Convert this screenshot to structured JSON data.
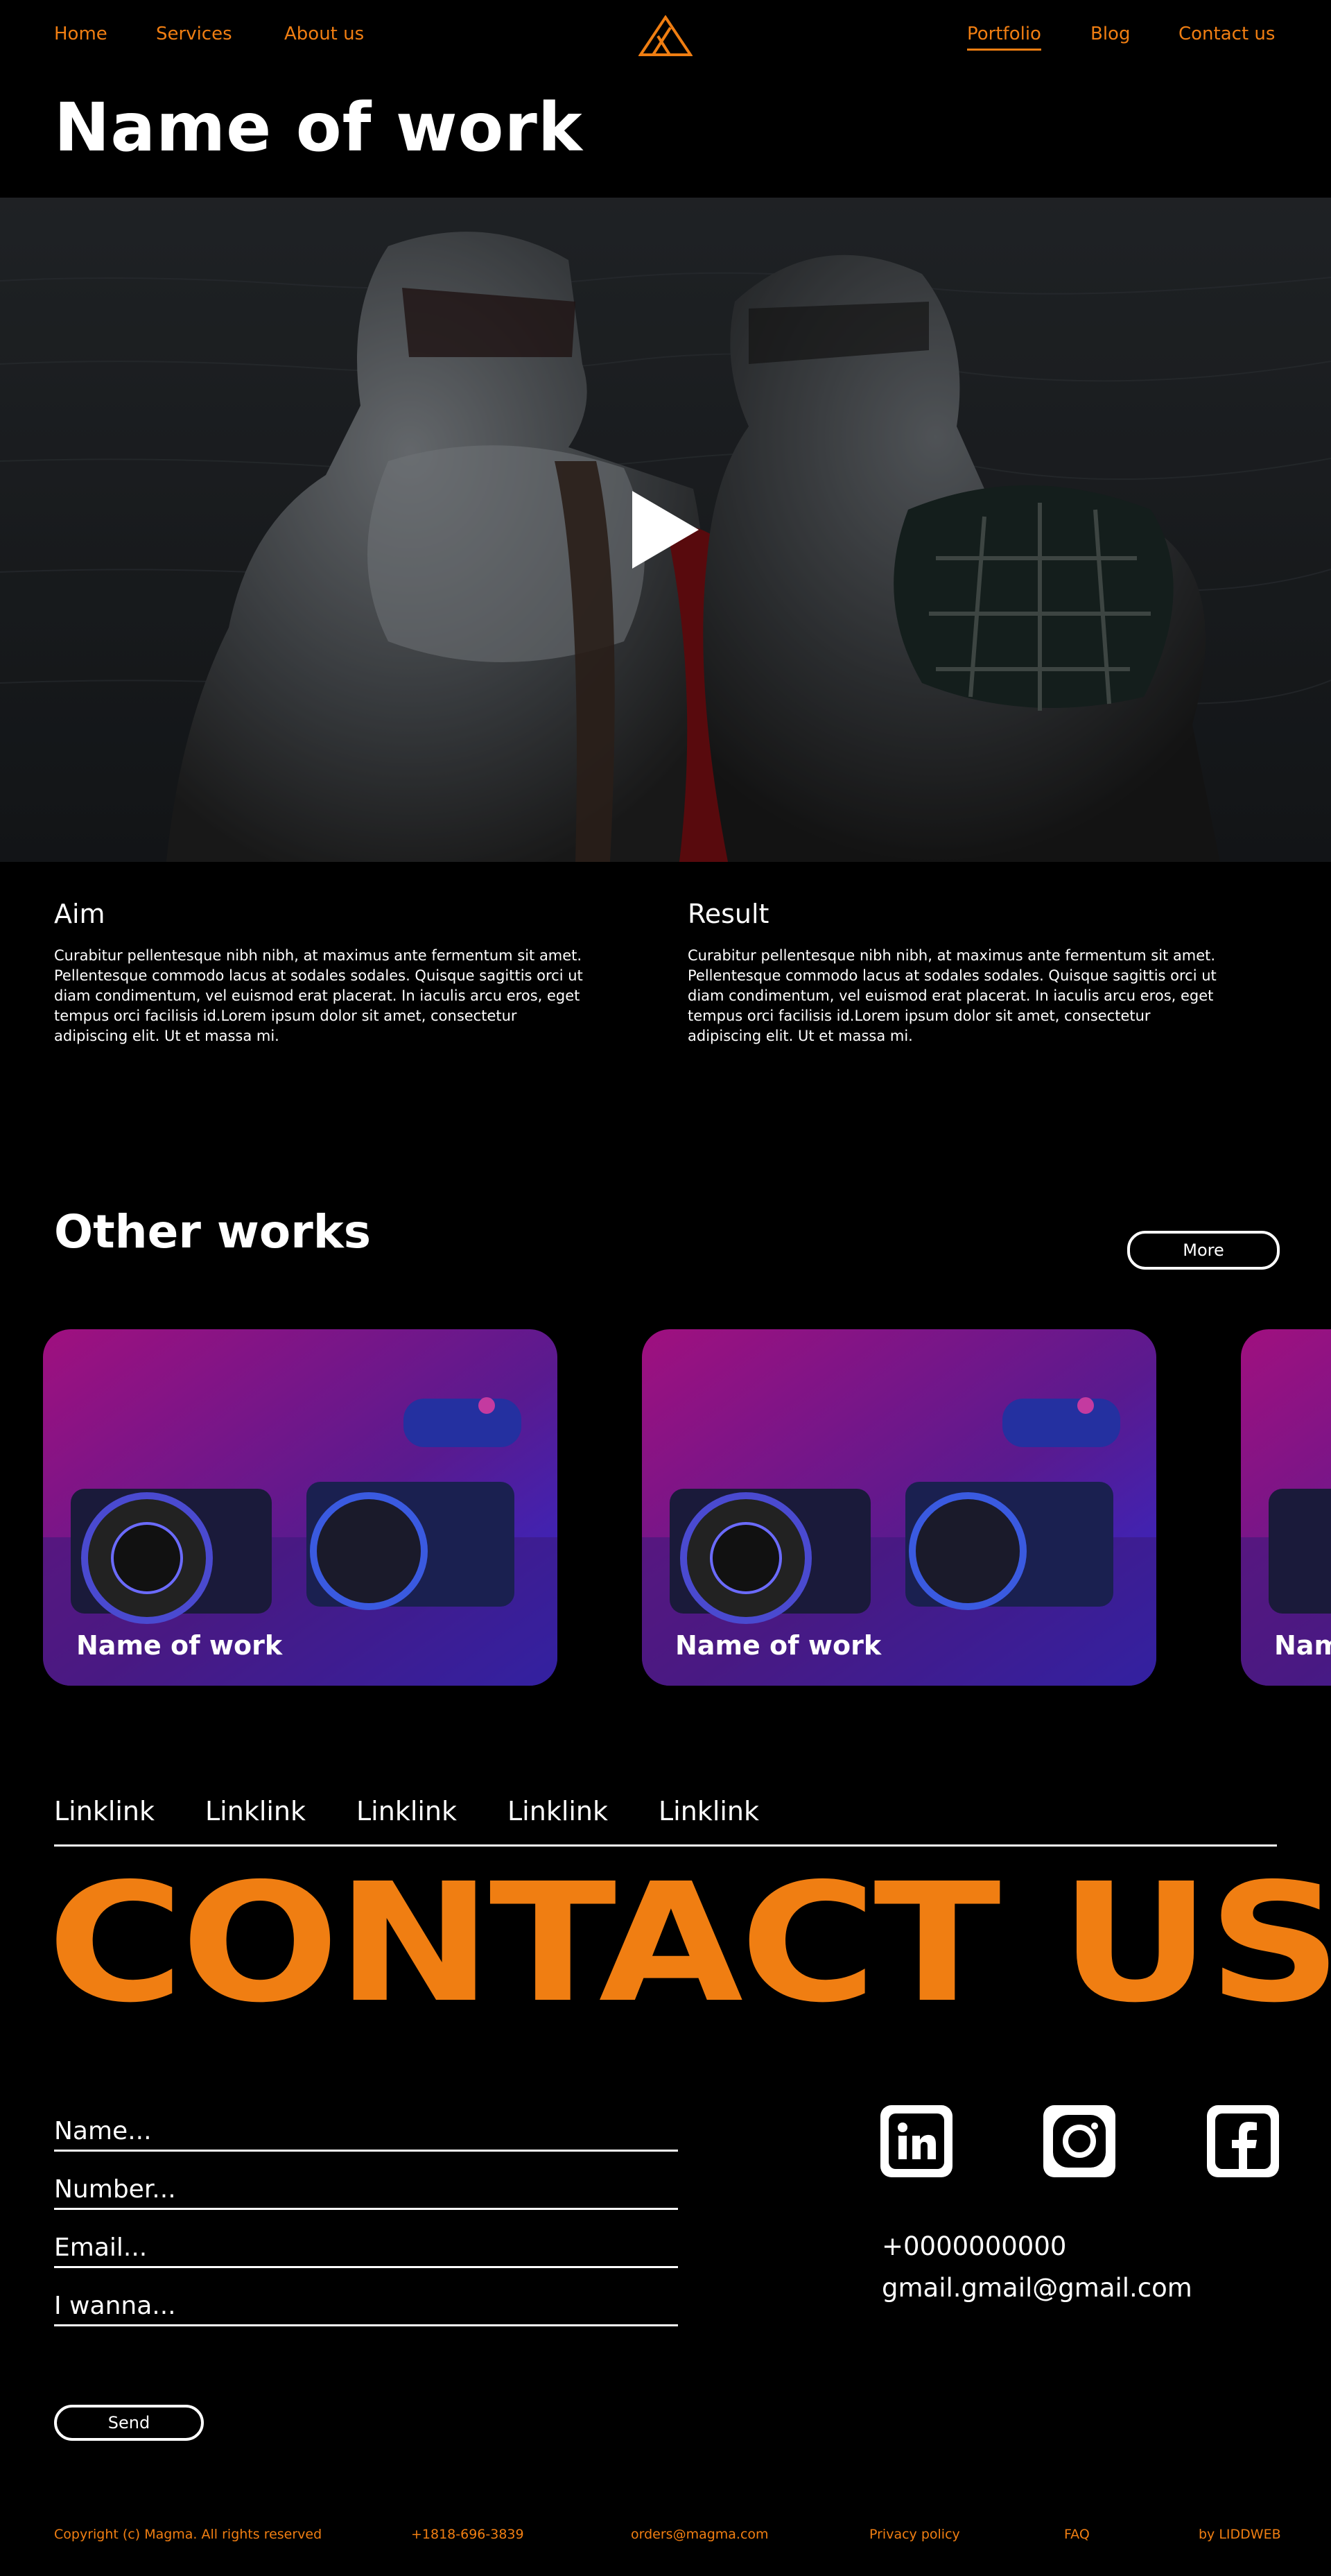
{
  "nav": {
    "left": [
      "Home",
      "Services",
      "About us"
    ],
    "right": [
      "Portfolio",
      "Blog",
      "Contact us"
    ],
    "active": "Portfolio",
    "logo_icon": "triangle-logo-icon"
  },
  "page_title": "Name of work",
  "hero": {
    "play_icon": "play-icon"
  },
  "aim": {
    "title": "Aim",
    "text": "Curabitur pellentesque nibh nibh, at maximus ante fermentum sit amet. Pellentesque commodo lacus at sodales sodales. Quisque sagittis orci ut diam condimentum, vel euismod erat placerat. In iaculis arcu eros, eget tempus orci facilisis id.Lorem ipsum dolor sit amet, consectetur adipiscing elit. Ut et massa mi."
  },
  "result": {
    "title": "Result",
    "text": "Curabitur pellentesque nibh nibh, at maximus ante fermentum sit amet. Pellentesque commodo lacus at sodales sodales. Quisque sagittis orci ut diam condimentum, vel euismod erat placerat. In iaculis arcu eros, eget tempus orci facilisis id.Lorem ipsum dolor sit amet, consectetur adipiscing elit. Ut et massa mi."
  },
  "other_works": {
    "title": "Other works",
    "more_label": "More",
    "cards": [
      {
        "title": "Name of work"
      },
      {
        "title": "Name of work"
      },
      {
        "title": "Name of work"
      }
    ]
  },
  "footer_links": [
    "Linklink",
    "Linklink",
    "Linklink",
    "Linklink",
    "Linklink"
  ],
  "contact_heading": "CONTACT US",
  "form": {
    "name_placeholder": "Name...",
    "number_placeholder": "Number...",
    "email_placeholder": "Email...",
    "message_placeholder": "I wanna...",
    "send_label": "Send"
  },
  "social_icons": [
    "linkedin-icon",
    "instagram-icon",
    "facebook-icon"
  ],
  "contact_info": {
    "phone": "+0000000000",
    "email": "gmail.gmail@gmail.com"
  },
  "bottom_bar": {
    "copyright": "Copyright (c) Magma. All rights reserved",
    "phone": "+1818-696-3839",
    "email": "orders@magma.com",
    "privacy": "Privacy policy",
    "faq": "FAQ",
    "credit": "by LIDDWEB"
  },
  "colors": {
    "accent": "#f07e12",
    "background": "#000000",
    "text": "#ffffff"
  }
}
